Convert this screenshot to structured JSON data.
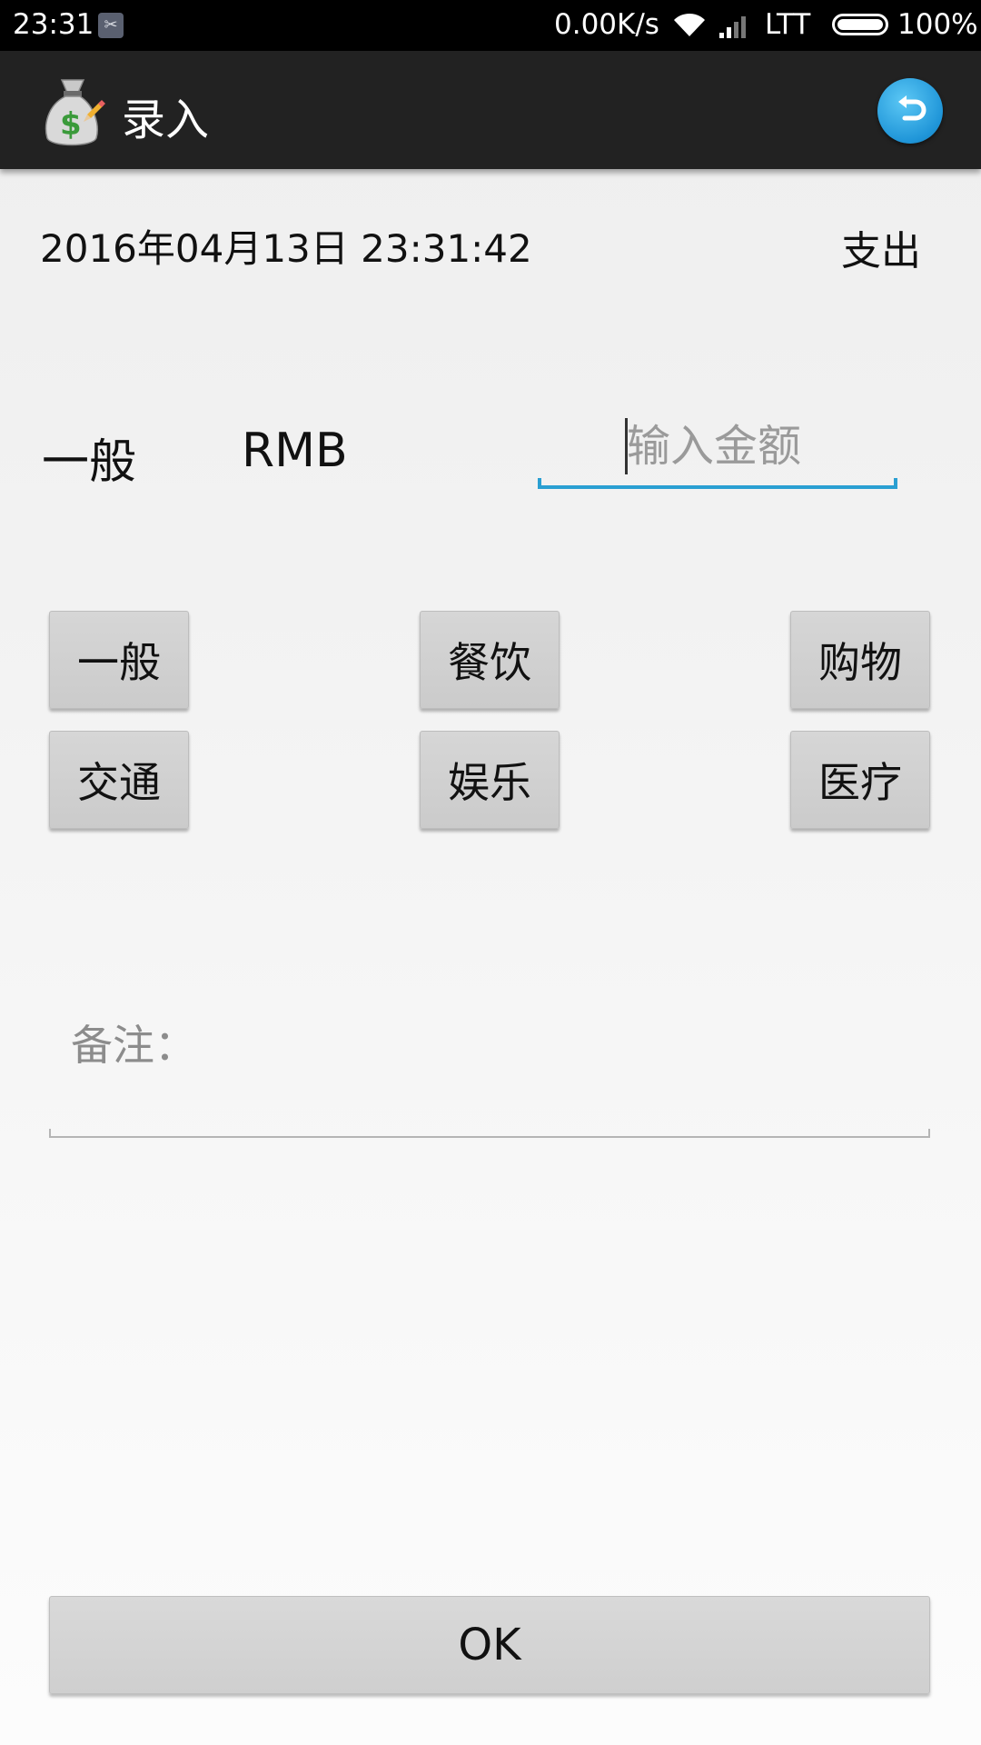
{
  "status_bar": {
    "time": "23:31",
    "speed": "0.00K/s",
    "carrier": "LTT",
    "battery": "100%",
    "battery_level": 1.0
  },
  "action_bar": {
    "title": "录入",
    "app_icon": "money-bag-pencil-icon",
    "undo_icon": "undo-arrow-icon",
    "accent_color": "#2196d8"
  },
  "form": {
    "datetime": "2016年04月13日 23:31:42",
    "type": "支出",
    "selected_category": "一般",
    "currency": "RMB",
    "amount": {
      "value": "",
      "placeholder": "输入金额"
    },
    "categories": [
      "一般",
      "餐饮",
      "购物",
      "交通",
      "娱乐",
      "医疗"
    ],
    "note_label": "备注：",
    "note_value": "",
    "ok_label": "OK"
  }
}
